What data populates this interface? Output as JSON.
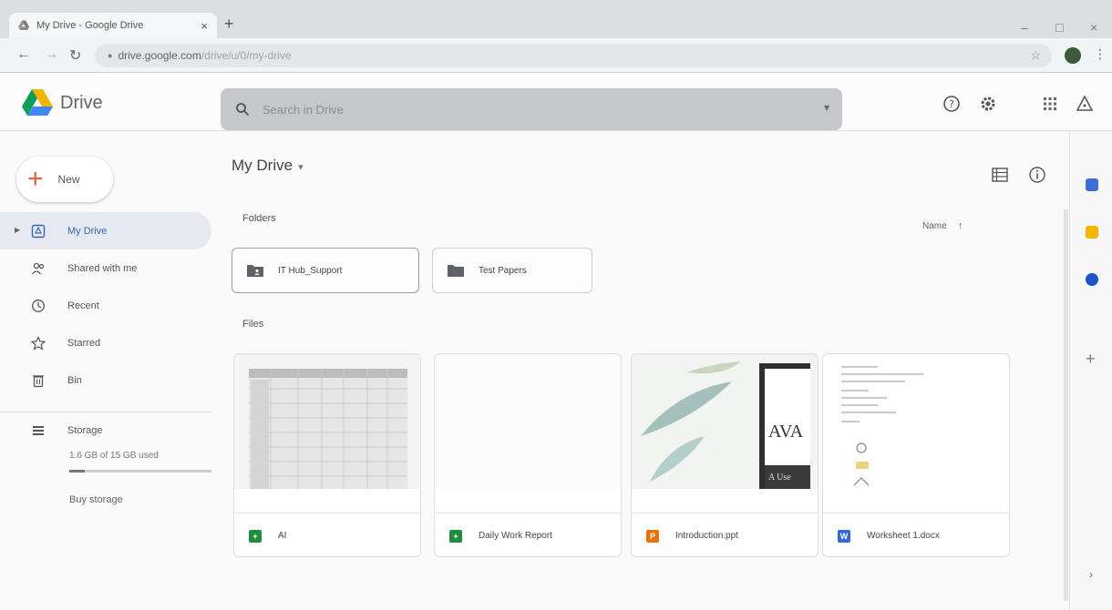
{
  "browser": {
    "tab_title": "My Drive - Google Drive",
    "tab_close": "×",
    "new_tab": "+",
    "address_domain": "drive.google.com",
    "address_path": "/drive/u/0/my-drive",
    "minimize": "–",
    "maximize": "□",
    "close": "×"
  },
  "header": {
    "brand": "Drive",
    "search_placeholder": "Search in Drive"
  },
  "sidebar": {
    "new_label": "New",
    "items": [
      {
        "label": "My Drive",
        "icon": "my-drive-icon",
        "active": true
      },
      {
        "label": "Shared with me",
        "icon": "people-icon"
      },
      {
        "label": "Recent",
        "icon": "clock-icon"
      },
      {
        "label": "Starred",
        "icon": "star-icon"
      },
      {
        "label": "Bin",
        "icon": "trash-icon"
      }
    ],
    "storage": {
      "label": "Storage",
      "used_text": "1.6 GB of 15 GB used",
      "used_fraction": 0.107,
      "buy_label": "Buy storage"
    }
  },
  "main": {
    "breadcrumb": "My Drive",
    "breadcrumb_caret": "▾",
    "folders_heading": "Folders",
    "files_heading": "Files",
    "sort_label": "Name",
    "sort_arrow": "↑",
    "folders": [
      {
        "name": "IT Hub_Support"
      },
      {
        "name": "Test Papers"
      }
    ],
    "files": [
      {
        "name": "AI",
        "type": "sheets",
        "color": "#1e8e3e"
      },
      {
        "name": "Daily Work Report",
        "type": "sheets",
        "color": "#1e8e3e"
      },
      {
        "name": "Introduction.ppt",
        "type": "slides",
        "color": "#e8710a"
      },
      {
        "name": "Worksheet 1.docx",
        "type": "docs",
        "color": "#3367d6"
      }
    ],
    "slide_thumb_text": "AVA",
    "slide_thumb_sub": "A Use"
  },
  "colors": {
    "accent": "#3367b3",
    "new_plus": "#e15b46",
    "active_nav_bg": "#e6eaf0"
  }
}
